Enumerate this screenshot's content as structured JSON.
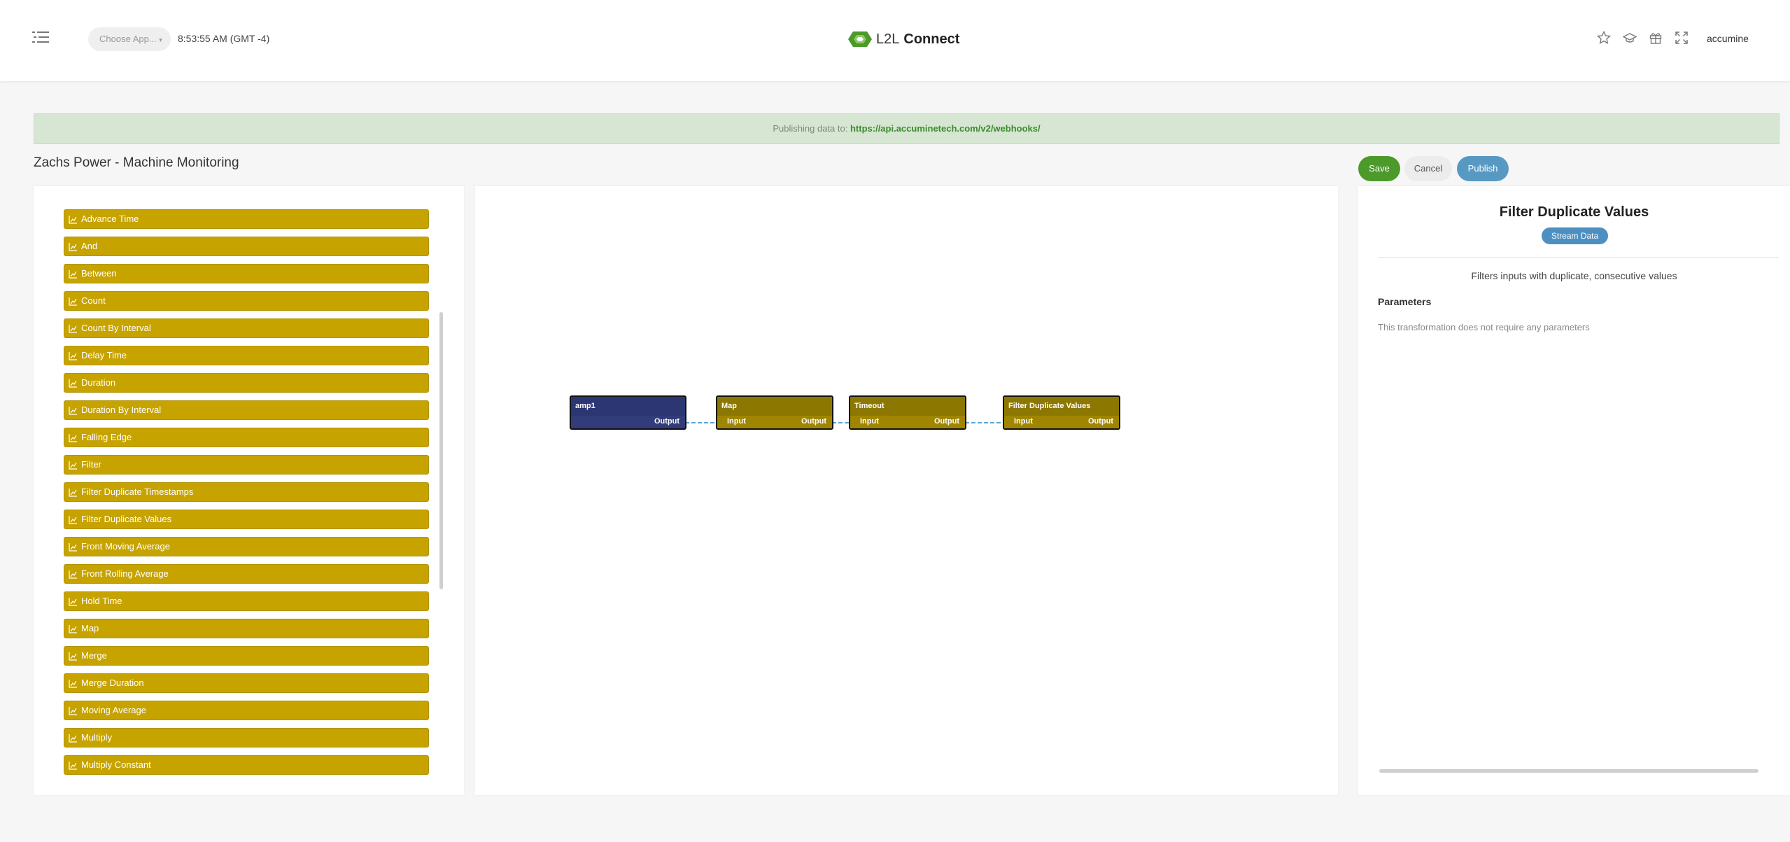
{
  "header": {
    "app_selector": "Choose App...",
    "clock": "8:53:55 AM (GMT -4)",
    "logo_l2l": "L2L",
    "logo_connect": "Connect",
    "username": "accumine"
  },
  "banner": {
    "prefix": "Publishing data to:",
    "url": "https://api.accuminetech.com/v2/webhooks/"
  },
  "page": {
    "title": "Zachs Power - Machine Monitoring"
  },
  "actions": {
    "save": "Save",
    "cancel": "Cancel",
    "publish": "Publish"
  },
  "palette": {
    "items": [
      "Advance Time",
      "And",
      "Between",
      "Count",
      "Count By Interval",
      "Delay Time",
      "Duration",
      "Duration By Interval",
      "Falling Edge",
      "Filter",
      "Filter Duplicate Timestamps",
      "Filter Duplicate Values",
      "Front Moving Average",
      "Front Rolling Average",
      "Hold Time",
      "Map",
      "Merge",
      "Merge Duration",
      "Moving Average",
      "Multiply",
      "Multiply Constant"
    ]
  },
  "canvas": {
    "nodes": [
      {
        "title": "amp1",
        "output": "Output"
      },
      {
        "title": "Map",
        "input": "Input",
        "output": "Output"
      },
      {
        "title": "Timeout",
        "input": "Input",
        "output": "Output"
      },
      {
        "title": "Filter Duplicate Values",
        "input": "Input",
        "output": "Output"
      }
    ]
  },
  "detail": {
    "title": "Filter Duplicate Values",
    "badge": "Stream Data",
    "description": "Filters inputs with duplicate, consecutive values",
    "params_heading": "Parameters",
    "params_note": "This transformation does not require any parameters"
  },
  "colors": {
    "palette_item": "#c7a300",
    "source_node": "#2c3672",
    "transform_node": "#8c7700",
    "connector": "#5aa6d6",
    "save": "#4c9a2a",
    "publish": "#5899c4",
    "badge": "#4e8fc2"
  },
  "icons": {
    "menu": "list-menu-icon",
    "star": "star-icon",
    "graduation": "graduation-cap-icon",
    "gift": "gift-icon",
    "fullscreen": "fullscreen-icon",
    "palette_item": "chart-line-icon"
  }
}
